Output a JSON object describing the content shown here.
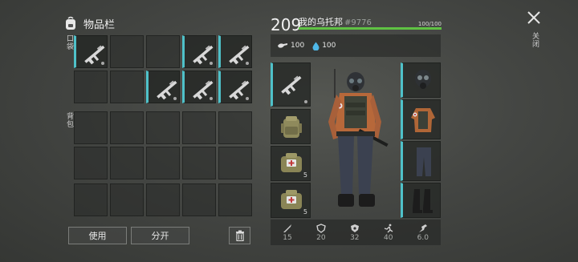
{
  "inventory": {
    "title": "物品栏",
    "pocket_label": "口袋",
    "backpack_label": "背包",
    "use_button": "使用",
    "split_button": "分开",
    "trash_icon": "trash-icon"
  },
  "player": {
    "level": "209",
    "name": "我的乌托邦",
    "id": "#9776",
    "hp_text": "100/100",
    "hp_fraction": 1.0,
    "food": "100",
    "water": "100"
  },
  "equipment": {
    "left_slots": [
      {
        "item": "rifle",
        "count": ""
      },
      {
        "item": "backpack",
        "count": ""
      },
      {
        "item": "medkit",
        "count": "5"
      },
      {
        "item": "medkit",
        "count": "5"
      }
    ],
    "right_slots": [
      {
        "item": "gas-mask"
      },
      {
        "item": "jacket"
      },
      {
        "item": "pants"
      },
      {
        "item": "boots"
      }
    ]
  },
  "attributes": [
    {
      "icon": "melee-icon",
      "value": "15"
    },
    {
      "icon": "armor-icon",
      "value": "20"
    },
    {
      "icon": "radiation-icon",
      "value": "32"
    },
    {
      "icon": "speed-icon",
      "value": "40"
    },
    {
      "icon": "stealth-icon",
      "value": "6.0"
    }
  ],
  "close_label": "关闭",
  "colors": {
    "accent": "#4fc1c9",
    "hp": "#5fc243"
  }
}
